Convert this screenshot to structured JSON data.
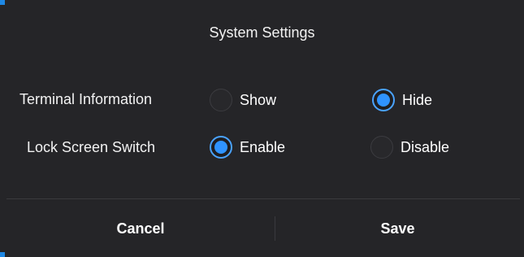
{
  "dialog": {
    "title": "System Settings",
    "accent_color": "#2f93ff",
    "rows": [
      {
        "label": "Terminal Information",
        "options": [
          {
            "label": "Show",
            "selected": false
          },
          {
            "label": "Hide",
            "selected": true
          }
        ]
      },
      {
        "label": "Lock Screen Switch",
        "options": [
          {
            "label": "Enable",
            "selected": true
          },
          {
            "label": "Disable",
            "selected": false
          }
        ]
      }
    ],
    "actions": {
      "cancel_label": "Cancel",
      "save_label": "Save"
    }
  }
}
